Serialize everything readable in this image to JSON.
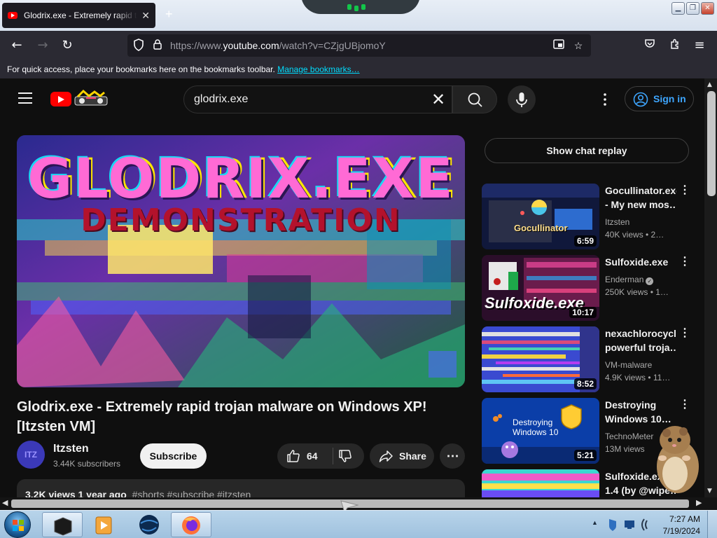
{
  "browser": {
    "tab": {
      "title": "Glodrix.exe - Extremely rapid trojan malware on Windows XP! [Itzsten VM]"
    },
    "url_prefix": "https://www.",
    "url_host": "youtube.com",
    "url_path": "/watch?v=CZjgUBjomoY",
    "bookmarks_hint": "For quick access, place your bookmarks here on the bookmarks toolbar.",
    "bookmarks_link": "Manage bookmarks…"
  },
  "youtube": {
    "search_value": "glodrix.exe",
    "sign_in": "Sign in",
    "video": {
      "art_title": "GLODRIX.EXE",
      "art_subtitle": "DEMONSTRATION",
      "title": "Glodrix.exe - Extremely rapid trojan malware on Windows XP! [Itzsten VM]",
      "channel": "Itzsten",
      "channel_avatar_text": "ITZ",
      "subscribers": "3.44K subscribers",
      "subscribe_label": "Subscribe",
      "likes": "64",
      "share_label": "Share",
      "views": "3.2K views",
      "age": "1 year ago",
      "tags": "#shorts #subscribe #itzsten"
    },
    "chat_replay": "Show chat replay",
    "recommendations": [
      {
        "title_line1": "Gocullinator.exe",
        "title_line2": "- My new mos…",
        "channel": "Itzsten",
        "verified": false,
        "meta": "40K views • 2…",
        "duration": "6:59",
        "thumb_text": "Gocullinator"
      },
      {
        "title_line1": "Sulfoxide.exe",
        "title_line2": "",
        "channel": "Enderman",
        "verified": true,
        "meta": "250K views • 1…",
        "duration": "10:17",
        "thumb_text": "Sulfoxide.exe"
      },
      {
        "title_line1": "nexachlorocyclc",
        "title_line2": "powerful troja…",
        "channel": "VM-malware",
        "verified": false,
        "meta": "4.9K views • 11…",
        "duration": "8:52",
        "thumb_text": ""
      },
      {
        "title_line1": "Destroying",
        "title_line2": "Windows 10…",
        "channel": "TechnoMeter",
        "verified": false,
        "meta": "13M views",
        "duration": "5:21",
        "thumb_text": "Destroying Windows 10"
      },
      {
        "title_line1": "Sulfoxide.exe",
        "title_line2": "1.4 (by @wipe…",
        "channel": "",
        "verified": false,
        "meta": "",
        "duration": "",
        "thumb_text": ""
      }
    ]
  },
  "taskbar": {
    "time": "7:27 AM",
    "date": "7/19/2024"
  },
  "colors": {
    "youtube_red": "#ff0000",
    "link_blue": "#3ea6ff",
    "page_bg": "#0f0f0f",
    "firefox_chrome": "#2b2a33"
  }
}
